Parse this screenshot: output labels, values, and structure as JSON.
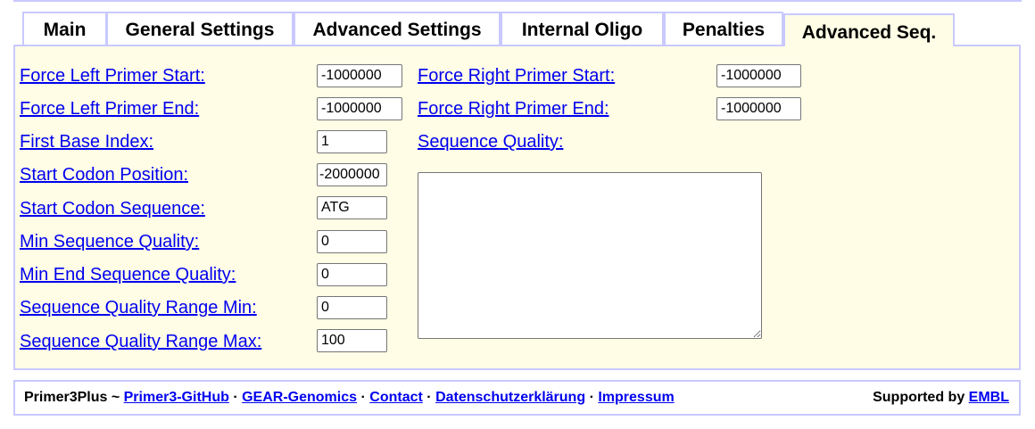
{
  "tabs": [
    "Main",
    "General Settings",
    "Advanced Settings",
    "Internal Oligo",
    "Penalties",
    "Advanced Seq."
  ],
  "left_fields": [
    {
      "label": "Force Left Primer Start:",
      "value": "-1000000"
    },
    {
      "label": "Force Left Primer End:",
      "value": "-1000000"
    },
    {
      "label": "First Base Index:",
      "value": "1"
    },
    {
      "label": "Start Codon Position:",
      "value": "-2000000"
    },
    {
      "label": "Start Codon Sequence:",
      "value": "ATG"
    },
    {
      "label": "Min Sequence Quality:",
      "value": "0"
    },
    {
      "label": "Min End Sequence Quality:",
      "value": "0"
    },
    {
      "label": "Sequence Quality Range Min:",
      "value": "0"
    },
    {
      "label": "Sequence Quality Range Max:",
      "value": "100"
    }
  ],
  "right_fields": [
    {
      "label": "Force Right Primer Start:",
      "value": "-1000000"
    },
    {
      "label": "Force Right Primer End:",
      "value": "-1000000"
    }
  ],
  "sequence_quality": {
    "label": "Sequence Quality:",
    "value": ""
  },
  "footer": {
    "brand": "Primer3Plus ~",
    "links": [
      "Primer3-GitHub",
      "GEAR-Genomics",
      "Contact",
      "Datenschutzerklärung",
      "Impressum"
    ],
    "sep": "·",
    "supported_by": "Supported by",
    "supporter": "EMBL"
  }
}
